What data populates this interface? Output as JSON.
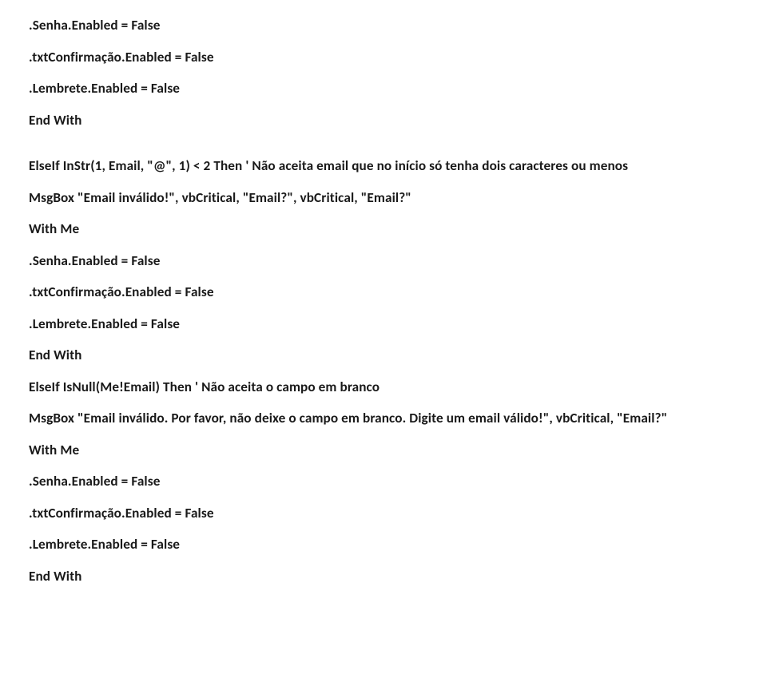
{
  "lines": {
    "l0": ".Senha.Enabled = False",
    "l1": ".txtConfirmação.Enabled = False",
    "l2": ".Lembrete.Enabled = False",
    "l3": "End With",
    "l4": "ElseIf InStr(1, Email, \"@\", 1) < 2 Then ' Não aceita email que no início só tenha dois caracteres ou menos",
    "l5": "MsgBox \"Email inválido!\", vbCritical, \"Email?\", vbCritical, \"Email?\"",
    "l6": "With Me",
    "l7": ".Senha.Enabled = False",
    "l8": ".txtConfirmação.Enabled = False",
    "l9": ".Lembrete.Enabled = False",
    "l10": "End With",
    "l11": "ElseIf IsNull(Me!Email) Then ' Não aceita o campo em branco",
    "l12": "MsgBox \"Email inválido. Por favor, não deixe o campo em branco. Digite um email válido!\", vbCritical, \"Email?\"",
    "l13": "With Me",
    "l14": ".Senha.Enabled = False",
    "l15": ".txtConfirmação.Enabled = False",
    "l16": ".Lembrete.Enabled = False",
    "l17": "End With"
  }
}
